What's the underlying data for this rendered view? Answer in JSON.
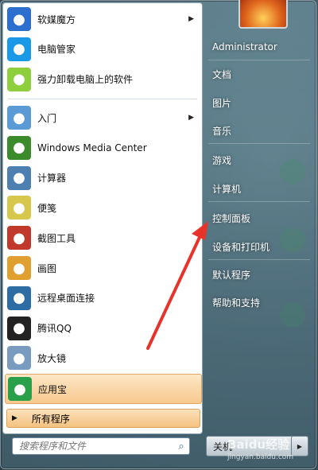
{
  "pinned": [
    {
      "label": "软媒魔方",
      "icon": "rubik-cube-icon",
      "color": "#2c6fcf",
      "submenu": true
    },
    {
      "label": "电脑管家",
      "icon": "shield-icon",
      "color": "#1a9ae6",
      "submenu": false
    },
    {
      "label": "强力卸载电脑上的软件",
      "icon": "flower-icon",
      "color": "#8fcf3d",
      "submenu": false
    }
  ],
  "recent": [
    {
      "label": "入门",
      "icon": "getting-started-icon",
      "color": "#5b9bd5",
      "submenu": true
    },
    {
      "label": "Windows Media Center",
      "icon": "media-center-icon",
      "color": "#3b8a2c",
      "submenu": false
    },
    {
      "label": "计算器",
      "icon": "calculator-icon",
      "color": "#4d7fb0",
      "submenu": false
    },
    {
      "label": "便笺",
      "icon": "sticky-notes-icon",
      "color": "#d7c84d",
      "submenu": false
    },
    {
      "label": "截图工具",
      "icon": "scissors-icon",
      "color": "#c0392b",
      "submenu": false
    },
    {
      "label": "画图",
      "icon": "paint-palette-icon",
      "color": "#e0a030",
      "submenu": false
    },
    {
      "label": "远程桌面连接",
      "icon": "remote-desktop-icon",
      "color": "#2e6da4",
      "submenu": false
    },
    {
      "label": "腾讯QQ",
      "icon": "qq-penguin-icon",
      "color": "#222222",
      "submenu": false
    },
    {
      "label": "放大镜",
      "icon": "magnifier-icon",
      "color": "#7a9bc0",
      "submenu": false
    },
    {
      "label": "应用宝",
      "icon": "app-store-icon",
      "color": "#2aa04a",
      "submenu": false
    }
  ],
  "all_programs": "所有程序",
  "search": {
    "placeholder": "搜索程序和文件"
  },
  "right_items": [
    {
      "label": "Administrator",
      "name": "user-folder"
    },
    {
      "label": "文档",
      "name": "documents"
    },
    {
      "label": "图片",
      "name": "pictures"
    },
    {
      "label": "音乐",
      "name": "music"
    },
    {
      "label": "游戏",
      "name": "games"
    },
    {
      "label": "计算机",
      "name": "computer"
    },
    {
      "label": "控制面板",
      "name": "control-panel"
    },
    {
      "label": "设备和打印机",
      "name": "devices-and-printers"
    },
    {
      "label": "默认程序",
      "name": "default-programs"
    },
    {
      "label": "帮助和支持",
      "name": "help-and-support"
    }
  ],
  "shutdown_label": "关机",
  "watermark": {
    "main": "Baidu经验",
    "sub": "jingyan.baidu.com"
  },
  "colors": {
    "highlight": "#f7c98d",
    "arrow": "#e8332b",
    "accent": "#3a6ea5"
  }
}
